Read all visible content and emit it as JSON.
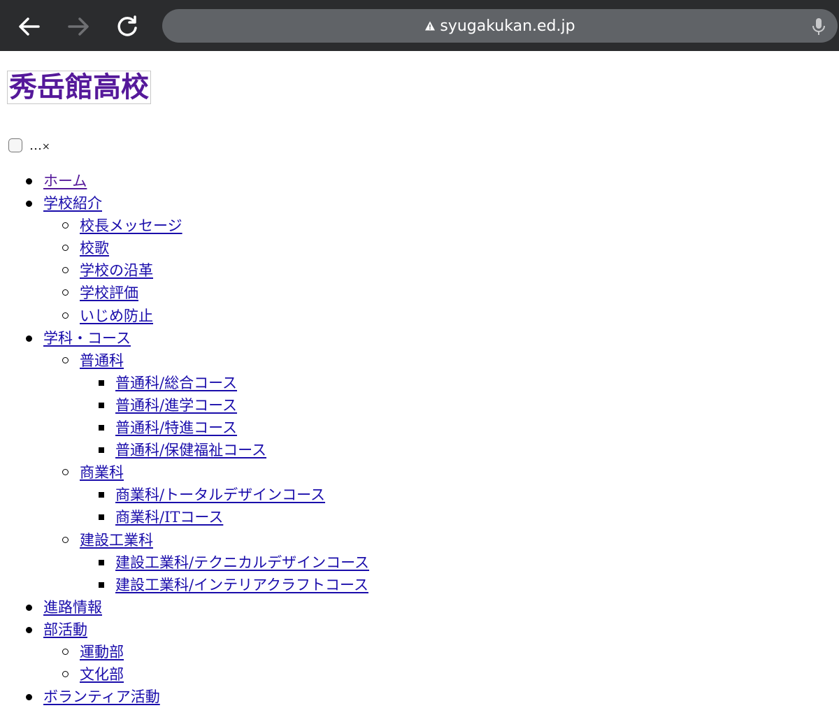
{
  "browser": {
    "url": "syugakukan.ed.jp",
    "icons": {
      "back": "arrow-left-icon",
      "forward": "arrow-right-icon",
      "reload": "reload-icon",
      "warning": "warning-triangle-icon",
      "mic": "microphone-icon"
    },
    "colors": {
      "toolbar": "#2b2c2e",
      "addressbar": "#606367"
    }
  },
  "site": {
    "logo_text": "秀岳館高校",
    "menu_toggle_text": "…",
    "menu_close_text": "×"
  },
  "nav": {
    "items": [
      {
        "label": "ホーム",
        "level": 1
      },
      {
        "label": "学校紹介",
        "level": 1
      },
      {
        "label": "校長メッセージ",
        "level": 2
      },
      {
        "label": "校歌",
        "level": 2
      },
      {
        "label": "学校の沿革",
        "level": 2
      },
      {
        "label": "学校評価",
        "level": 2
      },
      {
        "label": "いじめ防止",
        "level": 2
      },
      {
        "label": "学科・コース",
        "level": 1
      },
      {
        "label": "普通科",
        "level": 2
      },
      {
        "label": "普通科/総合コース",
        "level": 3
      },
      {
        "label": "普通科/進学コース",
        "level": 3
      },
      {
        "label": "普通科/特進コース",
        "level": 3
      },
      {
        "label": "普通科/保健福祉コース",
        "level": 3
      },
      {
        "label": "商業科",
        "level": 2
      },
      {
        "label": "商業科/トータルデザインコース",
        "level": 3
      },
      {
        "label": "商業科/ITコース",
        "level": 3
      },
      {
        "label": "建設工業科",
        "level": 2
      },
      {
        "label": "建設工業科/テクニカルデザインコース",
        "level": 3
      },
      {
        "label": "建設工業科/インテリアクラフトコース",
        "level": 3
      },
      {
        "label": "進路情報",
        "level": 1
      },
      {
        "label": "部活動",
        "level": 1
      },
      {
        "label": "運動部",
        "level": 2
      },
      {
        "label": "文化部",
        "level": 2
      },
      {
        "label": "ボランティア活動",
        "level": 1
      }
    ]
  }
}
